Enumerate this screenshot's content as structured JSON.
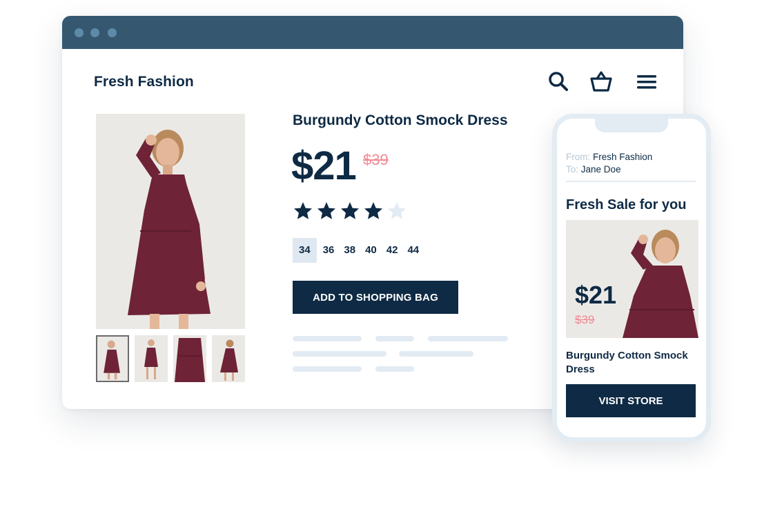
{
  "store": {
    "name": "Fresh Fashion"
  },
  "icons": {
    "search": "search-icon",
    "basket": "basket-icon",
    "menu": "hamburger-menu-icon"
  },
  "product": {
    "title": "Burgundy Cotton Smock Dress",
    "price": "$21",
    "old_price": "$39",
    "rating": 4,
    "rating_max": 5,
    "sizes": [
      "34",
      "36",
      "38",
      "40",
      "42",
      "44"
    ],
    "selected_size": "34",
    "add_button_label": "ADD TO SHOPPING BAG",
    "thumbnail_count": 4,
    "active_thumbnail": 1
  },
  "email": {
    "from_label": "From:",
    "from_value": "Fresh Fashion",
    "to_label": "To:",
    "to_value": "Jane Doe",
    "heading": "Fresh Sale for you",
    "price": "$21",
    "old_price": "$39",
    "product_title": "Burgundy Cotton Smock Dress",
    "button_label": "VISIT STORE"
  },
  "colors": {
    "navy": "#0e2a44",
    "titlebar": "#355870",
    "old_price": "#f08a94",
    "selected_size_bg": "#dfe8f1",
    "dress": "#6e2337"
  }
}
